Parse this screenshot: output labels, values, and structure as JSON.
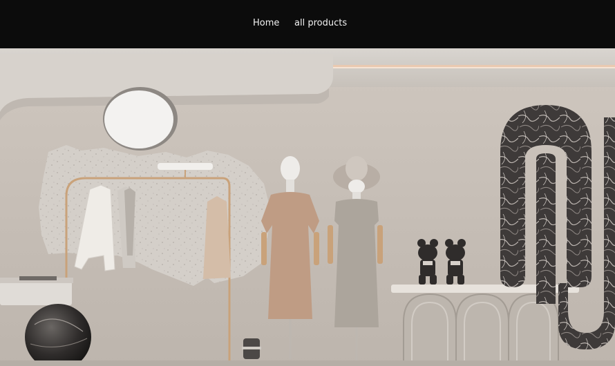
{
  "nav": {
    "items": [
      {
        "label": "Home"
      },
      {
        "label": "all products"
      }
    ]
  },
  "colors": {
    "navbar_bg": "#0c0c0c",
    "nav_text": "#f2f2f2",
    "wall": "#cfc8c1",
    "marble_dark": "#3e3a39",
    "accent_gold": "#c9a27a"
  },
  "icons": {
    "hero": "fashion-boutique-interior-photo"
  }
}
